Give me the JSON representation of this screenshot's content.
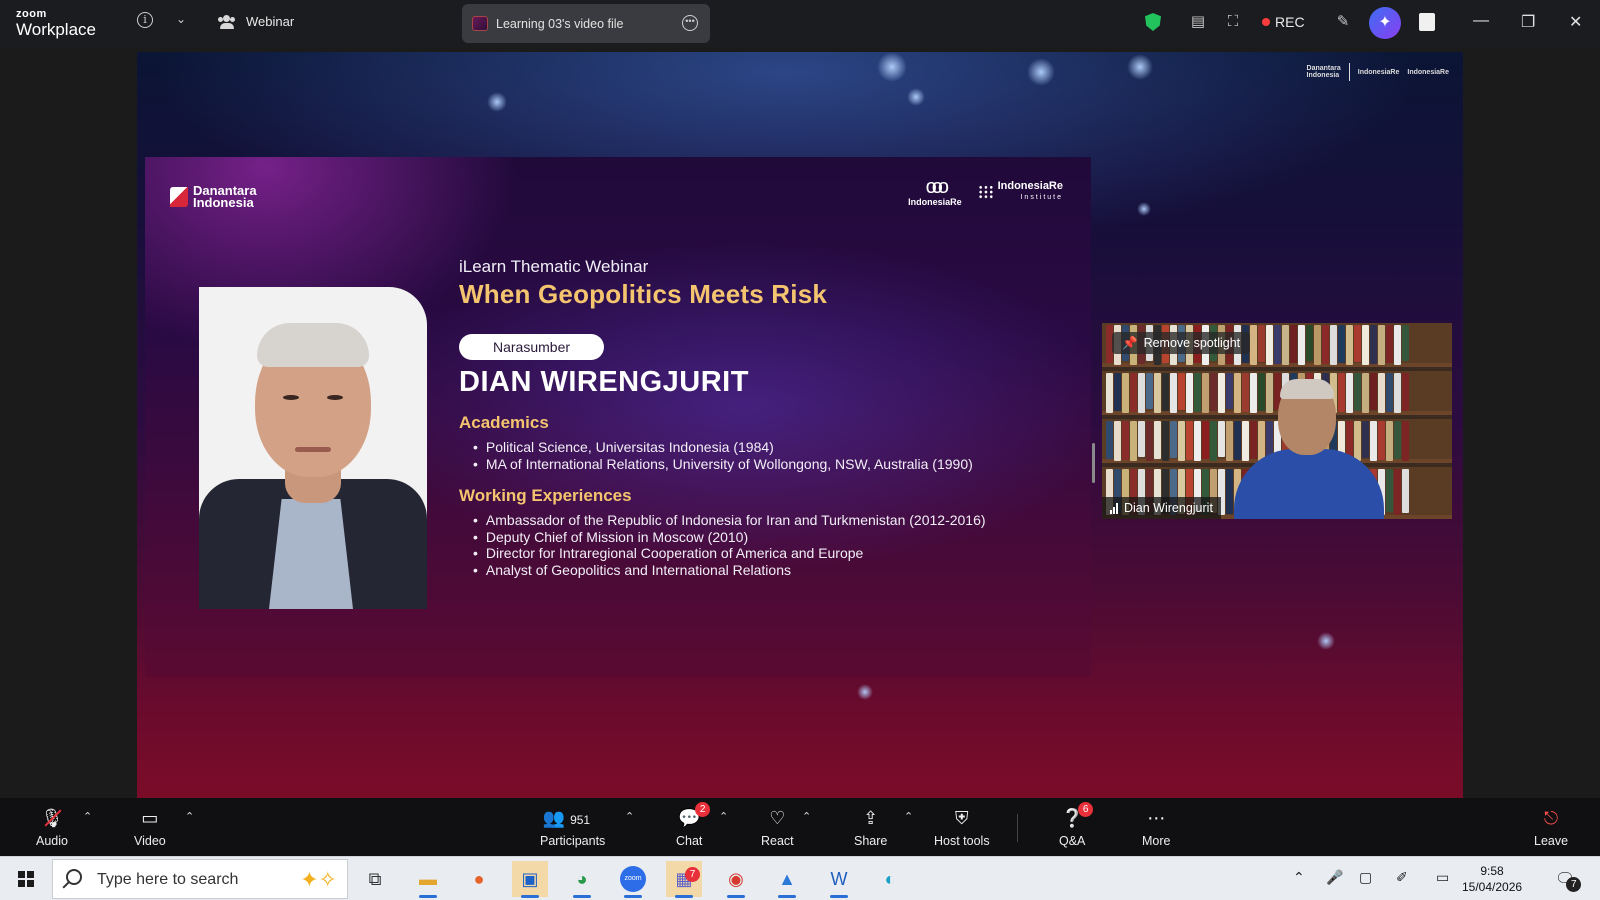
{
  "titlebar": {
    "brand_small": "zoom",
    "brand_large": "Workplace",
    "webinar_label": "Webinar",
    "tab_title": "Learning 03's video file",
    "rec_label": "REC"
  },
  "share": {
    "slide": {
      "left_logo_line1": "Danantara",
      "left_logo_line2": "Indonesia",
      "ire_logo": "IndonesiaRe",
      "institute_logo": "IndonesiaRe",
      "institute_sub": "Institute",
      "subtitle": "iLearn Thematic Webinar",
      "title": "When Geopolitics Meets Risk",
      "narasumber": "Narasumber",
      "speaker": "DIAN WIRENGJURIT",
      "academics_heading": "Academics",
      "academics": [
        "Political Science, Universitas Indonesia (1984)",
        "MA of International Relations, University of Wollongong, NSW, Australia (1990)"
      ],
      "work_heading": "Working Experiences",
      "work": [
        "Ambassador of the Republic of Indonesia for Iran and Turkmenistan (2012-2016)",
        "Deputy Chief of Mission in Moscow (2010)",
        "Director for Intraregional Cooperation of America and Europe",
        "Analyst of Geopolitics and International Relations"
      ]
    },
    "top_logos": {
      "a_line1": "Danantara",
      "a_line2": "Indonesia",
      "b": "IndonesiaRe",
      "c": "IndonesiaRe"
    }
  },
  "video": {
    "spotlight_label": "Remove spotlight",
    "participant_name": "Dian Wirengjurit"
  },
  "toolbar": {
    "audio": "Audio",
    "video": "Video",
    "participants": "Participants",
    "participants_count": "951",
    "chat": "Chat",
    "chat_badge": "2",
    "react": "React",
    "share": "Share",
    "host_tools": "Host tools",
    "qa": "Q&A",
    "qa_badge": "6",
    "more": "More",
    "leave": "Leave"
  },
  "taskbar": {
    "search_placeholder": "Type here to search",
    "teams_badge": "7",
    "time": "9:58",
    "date": "15/04/2026",
    "notif_badge": "7",
    "apps": [
      "file-explorer-icon",
      "firefox-icon",
      "outlook-icon",
      "chrome-profile-icon",
      "zoom-icon",
      "teams-icon",
      "chrome-icon",
      "photos-icon",
      "word-icon",
      "edge-icon"
    ]
  },
  "colors": {
    "accent_gold": "#f4c46f",
    "rec_red": "#ff3c3c",
    "shield_green": "#22c35d",
    "badge_red": "#e8303a"
  }
}
